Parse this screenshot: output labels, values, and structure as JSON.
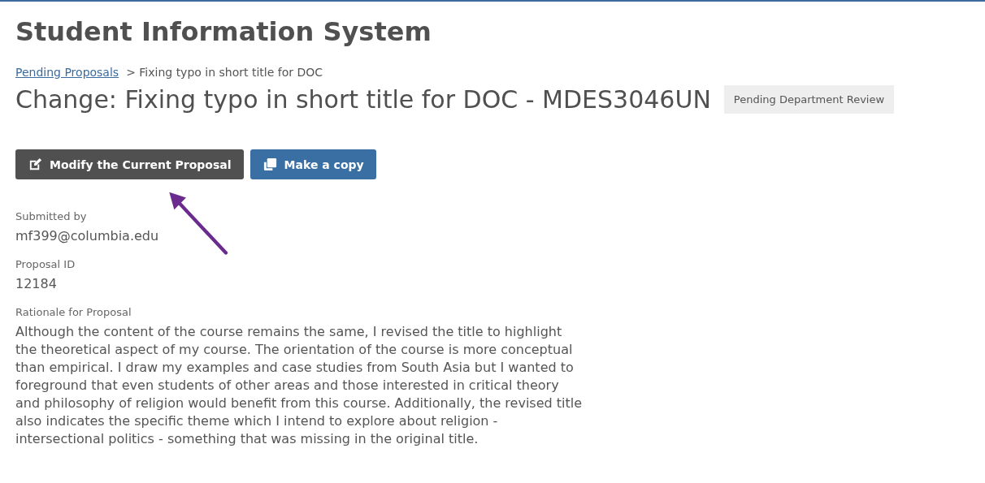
{
  "app_title": "Student Information System",
  "breadcrumb": {
    "link": "Pending Proposals",
    "current": "> Fixing typo in short title for DOC"
  },
  "heading": "Change: Fixing typo in short title for DOC - MDES3046UN",
  "status_badge": "Pending Department Review",
  "buttons": [
    {
      "label": "Modify the Current Proposal",
      "kind": "modify"
    },
    {
      "label": "Make a copy",
      "kind": "copy"
    }
  ],
  "fields": [
    {
      "label": "Submitted by",
      "value": "mf399@columbia.edu"
    },
    {
      "label": "Proposal ID",
      "value": "12184"
    },
    {
      "label": "Rationale for Proposal",
      "value": "Although the content of the course remains the same, I revised the title to highlight the theoretical aspect of my course. The orientation of the course is more conceptual than empirical. I draw my examples and case studies from South Asia but I wanted to foreground that even students of other areas and those interested in critical theory and philosophy of religion would benefit from this course. Additionally, the revised title also indicates the specific theme which I intend to explore about religion - intersectional politics - something that was missing in the original title."
    }
  ]
}
